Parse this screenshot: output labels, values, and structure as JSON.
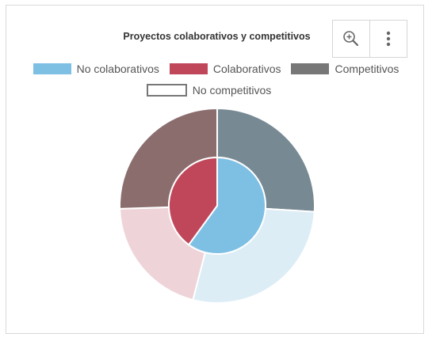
{
  "toolbar": {
    "zoom_icon": "zoom-in-icon",
    "menu_icon": "more-vertical-icon"
  },
  "chart_data": {
    "type": "pie",
    "title": "Proyectos colaborativos y competitivos",
    "legend_position": "top",
    "inner_ring": [
      {
        "name": "No colaborativos",
        "value": 60,
        "color": "#7ec0e4"
      },
      {
        "name": "Colaborativos",
        "value": 40,
        "color": "#c0475a"
      }
    ],
    "outer_ring": [
      {
        "value": 26,
        "color": "#778993"
      },
      {
        "value": 28,
        "color": "#dcedf6"
      },
      {
        "value": 20.5,
        "color": "#eed4d9"
      },
      {
        "value": 25.5,
        "color": "#8b6d6e"
      }
    ],
    "legend": [
      {
        "name": "No colaborativos",
        "color": "#7ec0e4",
        "style": "fill"
      },
      {
        "name": "Colaborativos",
        "color": "#c0475a",
        "style": "fill"
      },
      {
        "name": "Competitivos",
        "color": "#777777",
        "style": "fill"
      },
      {
        "name": "No competitivos",
        "color": "#777777",
        "style": "outline"
      }
    ]
  }
}
